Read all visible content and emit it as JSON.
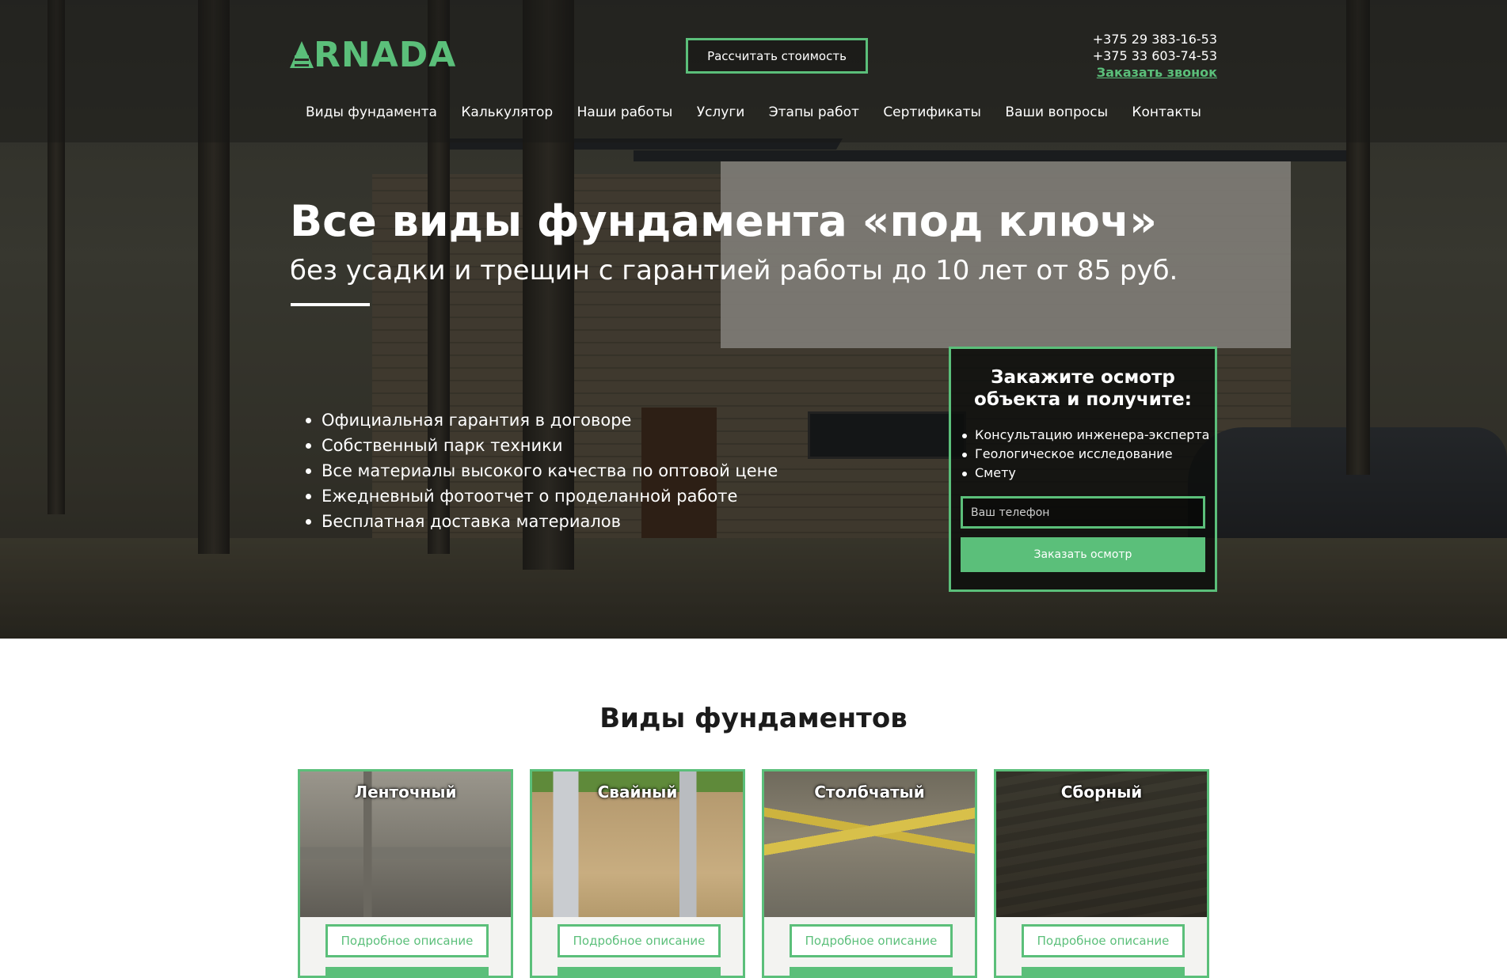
{
  "header": {
    "logo_text": "RNADA",
    "calc_button": "Рассчитать стоимость",
    "phones": [
      "+375 29 383-16-53",
      "+375 33 603-74-53"
    ],
    "callback_link": "Заказать звонок"
  },
  "nav": {
    "items": [
      {
        "label": "Виды фундамента"
      },
      {
        "label": "Калькулятор"
      },
      {
        "label": "Наши работы"
      },
      {
        "label": "Услуги"
      },
      {
        "label": "Этапы работ"
      },
      {
        "label": "Сертификаты"
      },
      {
        "label": "Ваши вопросы"
      },
      {
        "label": "Контакты"
      }
    ]
  },
  "hero": {
    "title": "Все виды фундамента «под ключ»",
    "subtitle": "без усадки и трещин с гарантией работы до 10 лет от 85 руб.",
    "features": [
      "Официальная гарантия в договоре",
      "Собственный парк техники",
      "Все материалы высокого качества по оптовой цене",
      "Ежедневный фотоотчет о проделанной работе",
      "Бесплатная доставка материалов"
    ]
  },
  "order_form": {
    "title_line1": "Закажите осмотр",
    "title_line2": "объекта и получите:",
    "items": [
      "Консультацию инженера-эксперта",
      "Геологическое исследование",
      "Смету"
    ],
    "phone_placeholder": "Ваш телефон",
    "submit_label": "Заказать осмотр"
  },
  "foundations": {
    "title": "Виды фундаментов",
    "detail_label": "Подробное описание",
    "cards": [
      {
        "title": "Ленточный"
      },
      {
        "title": "Свайный"
      },
      {
        "title": "Столбчатый"
      },
      {
        "title": "Сборный"
      }
    ]
  },
  "colors": {
    "accent": "#5bbf7a",
    "text_dark": "#1b1b1b"
  }
}
